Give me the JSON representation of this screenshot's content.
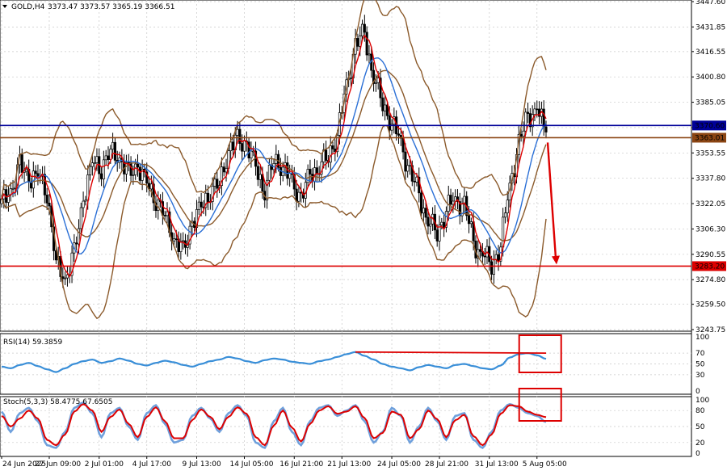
{
  "header": {
    "symbol": "GOLD,H4",
    "ohlc": "3373.47 3373.57 3365.19 3366.51"
  },
  "colors": {
    "background": "#ffffff",
    "grid": "#c8c8c8",
    "candle": "#000000",
    "ma_fast": "#dd0000",
    "ma_slow": "#2a6fd6",
    "bollinger": "#8b5a2b",
    "level_blue": "#000099",
    "level_brown": "#8b4513",
    "level_red": "#dd0000",
    "annotation": "#dd0000",
    "rsi_line": "#3a8fd8",
    "stoch_main": "#6fa0dc",
    "stoch_signal": "#dd0000"
  },
  "chart_data": [
    {
      "type": "candlestick",
      "panel": "price",
      "y_ticks": [
        "3447.60",
        "3431.85",
        "3416.55",
        "3400.80",
        "3385.05",
        "3369.30",
        "3353.55",
        "3337.80",
        "3322.05",
        "3306.30",
        "3290.55",
        "3274.80",
        "3259.50",
        "3243.75"
      ],
      "ylim": [
        3243.75,
        3447.6
      ],
      "horizontal_levels": [
        {
          "label": "3370.60",
          "value": 3370.6,
          "color_key": "level_blue"
        },
        {
          "label": "3363.01",
          "value": 3363.01,
          "color_key": "level_brown"
        },
        {
          "label": "3283.20",
          "value": 3283.2,
          "color_key": "level_red"
        }
      ],
      "anchors": [
        3322,
        3330,
        3345,
        3338,
        3340,
        3330,
        3285,
        3275,
        3290,
        3325,
        3348,
        3345,
        3355,
        3350,
        3340,
        3345,
        3335,
        3325,
        3315,
        3300,
        3292,
        3310,
        3320,
        3330,
        3335,
        3355,
        3362,
        3358,
        3345,
        3330,
        3350,
        3345,
        3335,
        3325,
        3340,
        3345,
        3352,
        3365,
        3395,
        3420,
        3428,
        3400,
        3385,
        3372,
        3360,
        3340,
        3328,
        3310,
        3305,
        3318,
        3325,
        3320,
        3298,
        3290,
        3285,
        3296,
        3335,
        3358,
        3377,
        3380,
        3366.51
      ],
      "x_labels": [
        "24 Jun 2025",
        "27 Jun 09:00",
        "2 Jul 01:00",
        "4 Jul 17:00",
        "9 Jul 13:00",
        "14 Jul 05:00",
        "16 Jul 21:00",
        "21 Jul 13:00",
        "24 Jul 05:00",
        "28 Jul 21:00",
        "31 Jul 13:00",
        "5 Aug 05:00"
      ],
      "overlays": [
        "fast moving average (red)",
        "slow moving average (blue)",
        "Bollinger Bands (brown)"
      ],
      "annotation": "red arrow pointing down from about 3360 toward the 3283.20 level"
    },
    {
      "type": "line",
      "panel": "rsi",
      "label": "RSI(14) 59.3859",
      "ylim": [
        0,
        100
      ],
      "y_ticks": [
        "100",
        "70",
        "50",
        "30",
        "0"
      ],
      "values": [
        45,
        42,
        48,
        52,
        46,
        40,
        35,
        42,
        50,
        55,
        58,
        52,
        55,
        60,
        56,
        50,
        47,
        52,
        56,
        53,
        48,
        45,
        50,
        55,
        58,
        63,
        60,
        55,
        52,
        57,
        60,
        58,
        54,
        52,
        50,
        55,
        58,
        63,
        68,
        72,
        65,
        58,
        50,
        45,
        42,
        38,
        44,
        48,
        45,
        42,
        48,
        50,
        46,
        42,
        40,
        47,
        62,
        68,
        70,
        66,
        59.39
      ],
      "trendline": {
        "from": [
          39,
          72
        ],
        "to": [
          60,
          70
        ]
      },
      "annotation": "red rectangle around the latest readings"
    },
    {
      "type": "line",
      "panel": "stochastic",
      "label": "Stoch(5,3,3) 58.4775 67.6505",
      "ylim": [
        0,
        100
      ],
      "y_ticks": [
        "100",
        "80",
        "50",
        "20",
        "0"
      ],
      "main_value": 58.4775,
      "signal_value": 67.6505,
      "main": [
        78,
        40,
        75,
        85,
        60,
        15,
        10,
        40,
        85,
        95,
        75,
        30,
        75,
        85,
        50,
        25,
        75,
        90,
        55,
        20,
        25,
        70,
        85,
        65,
        40,
        75,
        90,
        70,
        20,
        10,
        60,
        85,
        40,
        15,
        60,
        85,
        90,
        70,
        80,
        90,
        60,
        20,
        40,
        85,
        70,
        20,
        50,
        85,
        60,
        25,
        70,
        75,
        25,
        10,
        40,
        80,
        92,
        85,
        75,
        70,
        58.48
      ],
      "signal": [
        70,
        50,
        65,
        80,
        65,
        25,
        15,
        35,
        78,
        92,
        80,
        40,
        68,
        82,
        55,
        30,
        68,
        86,
        60,
        28,
        28,
        62,
        82,
        68,
        45,
        68,
        86,
        74,
        30,
        15,
        52,
        80,
        48,
        22,
        55,
        80,
        88,
        74,
        78,
        88,
        66,
        28,
        38,
        78,
        72,
        28,
        45,
        80,
        64,
        30,
        62,
        72,
        32,
        15,
        35,
        74,
        90,
        88,
        78,
        72,
        67.65
      ],
      "annotation": "red rectangle around the latest readings"
    }
  ]
}
